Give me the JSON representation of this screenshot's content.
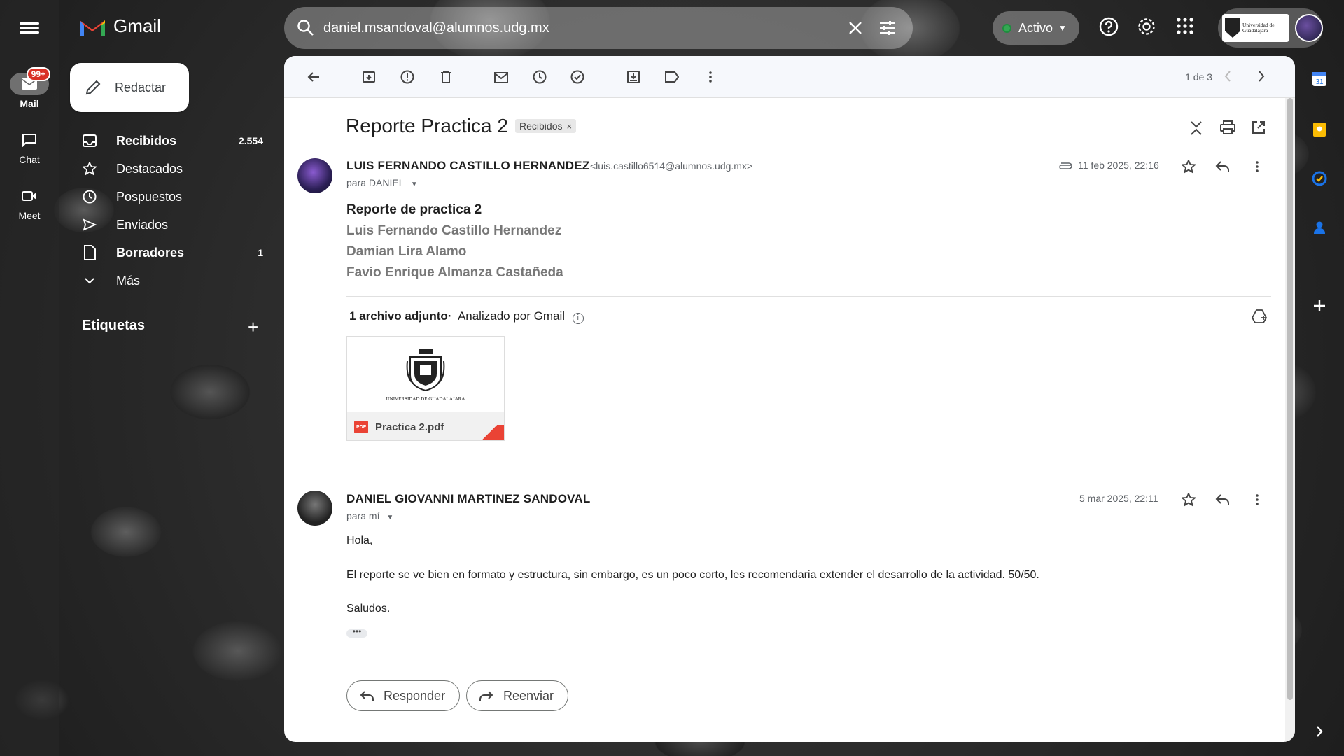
{
  "app": {
    "title": "Gmail"
  },
  "rail": {
    "mail_label": "Mail",
    "mail_badge": "99+",
    "chat_label": "Chat",
    "meet_label": "Meet"
  },
  "compose": {
    "label": "Redactar"
  },
  "nav": [
    {
      "label": "Recibidos",
      "count": "2.554",
      "bold": true,
      "icon": "inbox-icon"
    },
    {
      "label": "Destacados",
      "count": "",
      "bold": false,
      "icon": "star-icon"
    },
    {
      "label": "Pospuestos",
      "count": "",
      "bold": false,
      "icon": "clock-icon"
    },
    {
      "label": "Enviados",
      "count": "",
      "bold": false,
      "icon": "send-icon"
    },
    {
      "label": "Borradores",
      "count": "1",
      "bold": true,
      "icon": "draft-icon"
    },
    {
      "label": "Más",
      "count": "",
      "bold": false,
      "icon": "chevron-down-icon"
    }
  ],
  "labels": {
    "heading": "Etiquetas"
  },
  "search": {
    "value": "daniel.msandoval@alumnos.udg.mx"
  },
  "status": {
    "label": "Activo",
    "color": "#34a853"
  },
  "org": {
    "line1": "Universidad de",
    "line2": "Guadalajara"
  },
  "toolbar": {
    "pager": "1 de 3"
  },
  "thread": {
    "subject": "Reporte Practica 2",
    "tag": "Recibidos",
    "messages": [
      {
        "sender": "LUIS FERNANDO CASTILLO HERNANDEZ",
        "email": "<luis.castillo6514@alumnos.udg.mx>",
        "to": "para DANIEL",
        "date": "11 feb 2025, 22:16",
        "body_title": "Reporte de practica 2",
        "body_lines": [
          "Luis Fernando Castillo Hernandez",
          "Damian Lira Alamo",
          "Favio Enrique Almanza Castañeda"
        ],
        "attachments_heading": "1 archivo adjunto",
        "attachments_scan": "Analizado por Gmail",
        "attachment": {
          "name": "Practica 2.pdf",
          "preview_caption": "UNIVERSIDAD DE GUADALAJARA",
          "file_type": "PDF"
        }
      },
      {
        "sender": "DANIEL GIOVANNI MARTINEZ SANDOVAL",
        "to": "para mí",
        "date": "5 mar 2025, 22:11",
        "greeting": "Hola,",
        "body": "El reporte se ve bien en formato y estructura, sin embargo, es un poco corto, les recomendaria extender el desarrollo de la actividad. 50/50.",
        "closing": "Saludos."
      }
    ],
    "ellipsis": "•••"
  },
  "actions": {
    "reply": "Responder",
    "forward": "Reenviar"
  },
  "colors": {
    "accent_red": "#ea4335",
    "text_gray": "#5f6368"
  }
}
